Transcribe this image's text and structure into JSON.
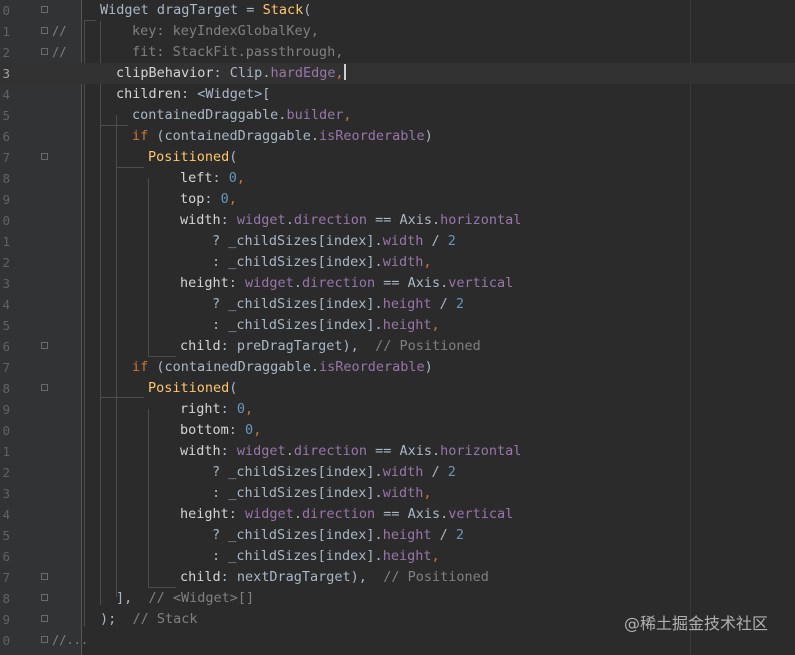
{
  "theme": {
    "background": "#2b2b2b",
    "gutter": "#313335",
    "default_text": "#a9b7c6",
    "keyword": "#cc7832",
    "class_name": "#ffc66d",
    "property": "#9876aa",
    "number": "#6897bb",
    "comment": "#808080",
    "param_text": "#d4d4d4"
  },
  "editor": {
    "line_numbers": [
      "0",
      "1",
      "2",
      "3",
      "4",
      "5",
      "6",
      "7",
      "8",
      "9",
      "0",
      "1",
      "2",
      "3",
      "4",
      "5",
      "6",
      "7",
      "8",
      "9",
      "0",
      "1",
      "2",
      "3",
      "4",
      "5",
      "6",
      "7",
      "8",
      "9",
      "0"
    ],
    "current_line_index": 3,
    "lines": [
      {
        "gutter_mark": "",
        "fold": true,
        "indent": 100,
        "tokens": [
          [
            "Widget dragTarget = ",
            "txt"
          ],
          [
            "Stack",
            "cls"
          ],
          [
            "(",
            "txt"
          ]
        ]
      },
      {
        "gutter_mark": "//",
        "fold": true,
        "indent": 132,
        "tokens": [
          [
            "key: keyIndexGlobalKey,",
            "cmt"
          ]
        ]
      },
      {
        "gutter_mark": "//",
        "fold": true,
        "indent": 132,
        "tokens": [
          [
            "fit: StackFit.passthrough,",
            "cmt"
          ]
        ]
      },
      {
        "gutter_mark": "",
        "fold": false,
        "indent": 116,
        "caret": true,
        "tokens": [
          [
            "clipBehavior",
            "prm"
          ],
          [
            ": Clip.",
            "txt"
          ],
          [
            "hardEdge",
            "prop"
          ],
          [
            ",",
            "kw"
          ]
        ]
      },
      {
        "gutter_mark": "",
        "fold": false,
        "indent": 116,
        "tokens": [
          [
            "children",
            "prm"
          ],
          [
            ": <Widget>[",
            "txt"
          ]
        ]
      },
      {
        "gutter_mark": "",
        "fold": false,
        "indent": 132,
        "tokens": [
          [
            "containedDraggable.",
            "txt"
          ],
          [
            "builder",
            "prop"
          ],
          [
            ",",
            "kw"
          ]
        ]
      },
      {
        "gutter_mark": "",
        "fold": false,
        "indent": 132,
        "tokens": [
          [
            "if ",
            "kw"
          ],
          [
            "(containedDraggable.",
            "txt"
          ],
          [
            "isReorderable",
            "prop"
          ],
          [
            ")",
            "txt"
          ]
        ]
      },
      {
        "gutter_mark": "",
        "fold": true,
        "indent": 148,
        "tokens": [
          [
            "Positioned",
            "cls"
          ],
          [
            "(",
            "txt"
          ]
        ]
      },
      {
        "gutter_mark": "",
        "fold": false,
        "indent": 180,
        "tokens": [
          [
            "left",
            "prm"
          ],
          [
            ": ",
            "txt"
          ],
          [
            "0",
            "num"
          ],
          [
            ",",
            "kw"
          ]
        ]
      },
      {
        "gutter_mark": "",
        "fold": false,
        "indent": 180,
        "tokens": [
          [
            "top",
            "prm"
          ],
          [
            ": ",
            "txt"
          ],
          [
            "0",
            "num"
          ],
          [
            ",",
            "kw"
          ]
        ]
      },
      {
        "gutter_mark": "",
        "fold": false,
        "indent": 180,
        "tokens": [
          [
            "width",
            "prm"
          ],
          [
            ": ",
            "txt"
          ],
          [
            "widget",
            "prop"
          ],
          [
            ".",
            "txt"
          ],
          [
            "direction",
            "prop"
          ],
          [
            " == Axis.",
            "txt"
          ],
          [
            "horizontal",
            "prop"
          ]
        ]
      },
      {
        "gutter_mark": "",
        "fold": false,
        "indent": 212,
        "tokens": [
          [
            "? _childSizes[index].",
            "txt"
          ],
          [
            "width",
            "prop"
          ],
          [
            " / ",
            "txt"
          ],
          [
            "2",
            "num"
          ]
        ]
      },
      {
        "gutter_mark": "",
        "fold": false,
        "indent": 212,
        "tokens": [
          [
            ": _childSizes[index].",
            "txt"
          ],
          [
            "width",
            "prop"
          ],
          [
            ",",
            "kw"
          ]
        ]
      },
      {
        "gutter_mark": "",
        "fold": false,
        "indent": 180,
        "tokens": [
          [
            "height",
            "prm"
          ],
          [
            ": ",
            "txt"
          ],
          [
            "widget",
            "prop"
          ],
          [
            ".",
            "txt"
          ],
          [
            "direction",
            "prop"
          ],
          [
            " == Axis.",
            "txt"
          ],
          [
            "vertical",
            "prop"
          ]
        ]
      },
      {
        "gutter_mark": "",
        "fold": false,
        "indent": 212,
        "tokens": [
          [
            "? _childSizes[index].",
            "txt"
          ],
          [
            "height",
            "prop"
          ],
          [
            " / ",
            "txt"
          ],
          [
            "2",
            "num"
          ]
        ]
      },
      {
        "gutter_mark": "",
        "fold": false,
        "indent": 212,
        "tokens": [
          [
            ": _childSizes[index].",
            "txt"
          ],
          [
            "height",
            "prop"
          ],
          [
            ",",
            "kw"
          ]
        ]
      },
      {
        "gutter_mark": "",
        "fold": true,
        "indent": 180,
        "tokens": [
          [
            "child",
            "prm"
          ],
          [
            ": preDragTarget),  ",
            "txt"
          ],
          [
            "// Positioned",
            "cmt"
          ]
        ]
      },
      {
        "gutter_mark": "",
        "fold": false,
        "indent": 132,
        "tokens": [
          [
            "if ",
            "kw"
          ],
          [
            "(containedDraggable.",
            "txt"
          ],
          [
            "isReorderable",
            "prop"
          ],
          [
            ")",
            "txt"
          ]
        ]
      },
      {
        "gutter_mark": "",
        "fold": true,
        "indent": 148,
        "tokens": [
          [
            "Positioned",
            "cls"
          ],
          [
            "(",
            "txt"
          ]
        ]
      },
      {
        "gutter_mark": "",
        "fold": false,
        "indent": 180,
        "tokens": [
          [
            "right",
            "prm"
          ],
          [
            ": ",
            "txt"
          ],
          [
            "0",
            "num"
          ],
          [
            ",",
            "kw"
          ]
        ]
      },
      {
        "gutter_mark": "",
        "fold": false,
        "indent": 180,
        "tokens": [
          [
            "bottom",
            "prm"
          ],
          [
            ": ",
            "txt"
          ],
          [
            "0",
            "num"
          ],
          [
            ",",
            "kw"
          ]
        ]
      },
      {
        "gutter_mark": "",
        "fold": false,
        "indent": 180,
        "tokens": [
          [
            "width",
            "prm"
          ],
          [
            ": ",
            "txt"
          ],
          [
            "widget",
            "prop"
          ],
          [
            ".",
            "txt"
          ],
          [
            "direction",
            "prop"
          ],
          [
            " == Axis.",
            "txt"
          ],
          [
            "horizontal",
            "prop"
          ]
        ]
      },
      {
        "gutter_mark": "",
        "fold": false,
        "indent": 212,
        "tokens": [
          [
            "? _childSizes[index].",
            "txt"
          ],
          [
            "width",
            "prop"
          ],
          [
            " / ",
            "txt"
          ],
          [
            "2",
            "num"
          ]
        ]
      },
      {
        "gutter_mark": "",
        "fold": false,
        "indent": 212,
        "tokens": [
          [
            ": _childSizes[index].",
            "txt"
          ],
          [
            "width",
            "prop"
          ],
          [
            ",",
            "kw"
          ]
        ]
      },
      {
        "gutter_mark": "",
        "fold": false,
        "indent": 180,
        "tokens": [
          [
            "height",
            "prm"
          ],
          [
            ": ",
            "txt"
          ],
          [
            "widget",
            "prop"
          ],
          [
            ".",
            "txt"
          ],
          [
            "direction",
            "prop"
          ],
          [
            " == Axis.",
            "txt"
          ],
          [
            "vertical",
            "prop"
          ]
        ]
      },
      {
        "gutter_mark": "",
        "fold": false,
        "indent": 212,
        "tokens": [
          [
            "? _childSizes[index].",
            "txt"
          ],
          [
            "height",
            "prop"
          ],
          [
            " / ",
            "txt"
          ],
          [
            "2",
            "num"
          ]
        ]
      },
      {
        "gutter_mark": "",
        "fold": false,
        "indent": 212,
        "tokens": [
          [
            ": _childSizes[index].",
            "txt"
          ],
          [
            "height",
            "prop"
          ],
          [
            ",",
            "kw"
          ]
        ]
      },
      {
        "gutter_mark": "",
        "fold": true,
        "indent": 180,
        "tokens": [
          [
            "child",
            "prm"
          ],
          [
            ": nextDragTarget),  ",
            "txt"
          ],
          [
            "// Positioned",
            "cmt"
          ]
        ]
      },
      {
        "gutter_mark": "",
        "fold": true,
        "indent": 116,
        "tokens": [
          [
            "],  ",
            "txt"
          ],
          [
            "// <Widget>[]",
            "cmt"
          ]
        ]
      },
      {
        "gutter_mark": "",
        "fold": true,
        "indent": 100,
        "tokens": [
          [
            ");  ",
            "txt"
          ],
          [
            "// Stack",
            "cmt"
          ]
        ]
      },
      {
        "gutter_mark": "//...",
        "fold": true,
        "indent": 100,
        "tokens": []
      }
    ]
  },
  "watermark": "@稀土掘金技术社区"
}
